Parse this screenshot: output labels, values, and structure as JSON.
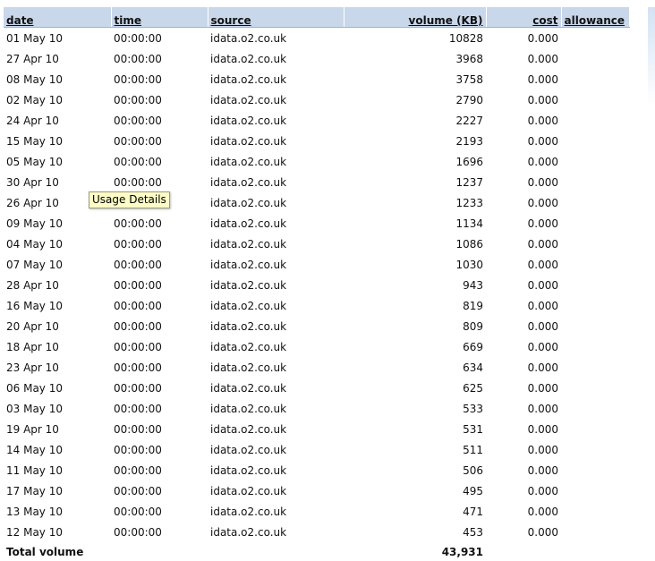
{
  "columns": {
    "date": "date",
    "time": "time",
    "source": "source",
    "volume": "volume (KB)",
    "cost": "cost",
    "allowance": "allowance"
  },
  "rows": [
    {
      "date": "01 May 10",
      "time": "00:00:00",
      "source": "idata.o2.co.uk",
      "volume": "10828",
      "cost": "0.000",
      "allowance": ""
    },
    {
      "date": "27 Apr 10",
      "time": "00:00:00",
      "source": "idata.o2.co.uk",
      "volume": "3968",
      "cost": "0.000",
      "allowance": ""
    },
    {
      "date": "08 May 10",
      "time": "00:00:00",
      "source": "idata.o2.co.uk",
      "volume": "3758",
      "cost": "0.000",
      "allowance": ""
    },
    {
      "date": "02 May 10",
      "time": "00:00:00",
      "source": "idata.o2.co.uk",
      "volume": "2790",
      "cost": "0.000",
      "allowance": ""
    },
    {
      "date": "24 Apr 10",
      "time": "00:00:00",
      "source": "idata.o2.co.uk",
      "volume": "2227",
      "cost": "0.000",
      "allowance": ""
    },
    {
      "date": "15 May 10",
      "time": "00:00:00",
      "source": "idata.o2.co.uk",
      "volume": "2193",
      "cost": "0.000",
      "allowance": ""
    },
    {
      "date": "05 May 10",
      "time": "00:00:00",
      "source": "idata.o2.co.uk",
      "volume": "1696",
      "cost": "0.000",
      "allowance": ""
    },
    {
      "date": "30 Apr 10",
      "time": "00:00:00",
      "source": "idata.o2.co.uk",
      "volume": "1237",
      "cost": "0.000",
      "allowance": ""
    },
    {
      "date": "26 Apr 10",
      "time": "00:00:00",
      "source": "idata.o2.co.uk",
      "volume": "1233",
      "cost": "0.000",
      "allowance": ""
    },
    {
      "date": "09 May 10",
      "time": "00:00:00",
      "source": "idata.o2.co.uk",
      "volume": "1134",
      "cost": "0.000",
      "allowance": ""
    },
    {
      "date": "04 May 10",
      "time": "00:00:00",
      "source": "idata.o2.co.uk",
      "volume": "1086",
      "cost": "0.000",
      "allowance": ""
    },
    {
      "date": "07 May 10",
      "time": "00:00:00",
      "source": "idata.o2.co.uk",
      "volume": "1030",
      "cost": "0.000",
      "allowance": ""
    },
    {
      "date": "28 Apr 10",
      "time": "00:00:00",
      "source": "idata.o2.co.uk",
      "volume": "943",
      "cost": "0.000",
      "allowance": ""
    },
    {
      "date": "16 May 10",
      "time": "00:00:00",
      "source": "idata.o2.co.uk",
      "volume": "819",
      "cost": "0.000",
      "allowance": ""
    },
    {
      "date": "20 Apr 10",
      "time": "00:00:00",
      "source": "idata.o2.co.uk",
      "volume": "809",
      "cost": "0.000",
      "allowance": ""
    },
    {
      "date": "18 Apr 10",
      "time": "00:00:00",
      "source": "idata.o2.co.uk",
      "volume": "669",
      "cost": "0.000",
      "allowance": ""
    },
    {
      "date": "23 Apr 10",
      "time": "00:00:00",
      "source": "idata.o2.co.uk",
      "volume": "634",
      "cost": "0.000",
      "allowance": ""
    },
    {
      "date": "06 May 10",
      "time": "00:00:00",
      "source": "idata.o2.co.uk",
      "volume": "625",
      "cost": "0.000",
      "allowance": ""
    },
    {
      "date": "03 May 10",
      "time": "00:00:00",
      "source": "idata.o2.co.uk",
      "volume": "533",
      "cost": "0.000",
      "allowance": ""
    },
    {
      "date": "19 Apr 10",
      "time": "00:00:00",
      "source": "idata.o2.co.uk",
      "volume": "531",
      "cost": "0.000",
      "allowance": ""
    },
    {
      "date": "14 May 10",
      "time": "00:00:00",
      "source": "idata.o2.co.uk",
      "volume": "511",
      "cost": "0.000",
      "allowance": ""
    },
    {
      "date": "11 May 10",
      "time": "00:00:00",
      "source": "idata.o2.co.uk",
      "volume": "506",
      "cost": "0.000",
      "allowance": ""
    },
    {
      "date": "17 May 10",
      "time": "00:00:00",
      "source": "idata.o2.co.uk",
      "volume": "495",
      "cost": "0.000",
      "allowance": ""
    },
    {
      "date": "13 May 10",
      "time": "00:00:00",
      "source": "idata.o2.co.uk",
      "volume": "471",
      "cost": "0.000",
      "allowance": ""
    },
    {
      "date": "12 May 10",
      "time": "00:00:00",
      "source": "idata.o2.co.uk",
      "volume": "453",
      "cost": "0.000",
      "allowance": ""
    }
  ],
  "footer": {
    "label": "Total volume",
    "total": "43,931"
  },
  "tooltip": "Usage Details",
  "colors": {
    "header_bg": "#c9d7ea",
    "tooltip_bg": "#fdfbc6"
  }
}
